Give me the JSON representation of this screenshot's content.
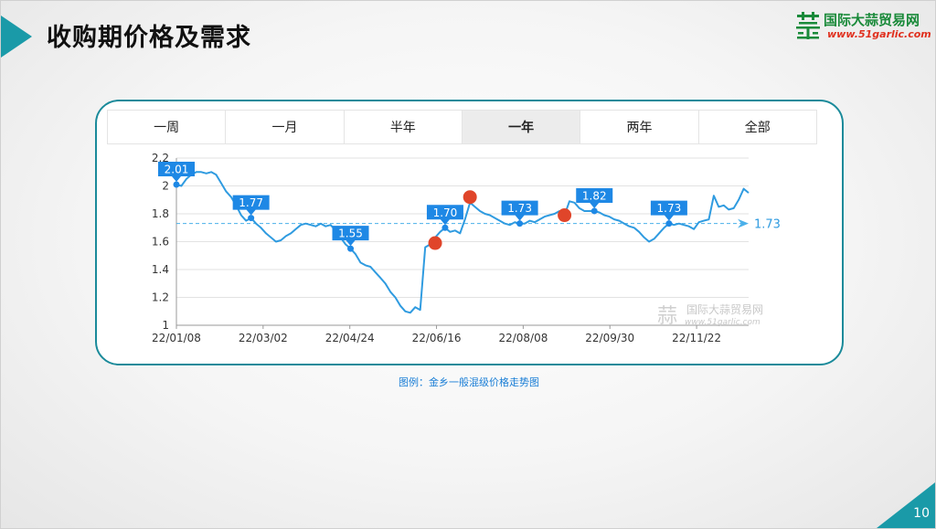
{
  "slide": {
    "title": "收购期价格及需求",
    "page_number": "10",
    "caption": "图例：金乡一般混级价格走势图"
  },
  "logo": {
    "name": "国际大蒜贸易网",
    "url": "www.51garlic.com",
    "icon": "garlic-logo-icon"
  },
  "tabs": [
    {
      "label": "一周",
      "active": false
    },
    {
      "label": "一月",
      "active": false
    },
    {
      "label": "半年",
      "active": false
    },
    {
      "label": "一年",
      "active": true
    },
    {
      "label": "两年",
      "active": false
    },
    {
      "label": "全部",
      "active": false
    }
  ],
  "colors": {
    "accent": "#1a9aa8",
    "line": "#2f9be0",
    "marker": "#e0452a",
    "label_bg": "#1e88e5"
  },
  "chart_data": {
    "type": "line",
    "ylim": [
      1,
      2.2
    ],
    "yticks": [
      1,
      1.2,
      1.4,
      1.6,
      1.8,
      2,
      2.2
    ],
    "xtick_labels": [
      "22/01/08",
      "22/03/02",
      "22/04/24",
      "22/06/16",
      "22/08/08",
      "22/09/30",
      "22/11/22"
    ],
    "grid": true,
    "series": [
      {
        "values": [
          2.01,
          2.0,
          2.05,
          2.08,
          2.1,
          2.1,
          2.09,
          2.1,
          2.08,
          2.02,
          1.96,
          1.92,
          1.86,
          1.79,
          1.75,
          1.77,
          1.73,
          1.7,
          1.66,
          1.63,
          1.6,
          1.61,
          1.64,
          1.66,
          1.69,
          1.72,
          1.73,
          1.72,
          1.71,
          1.73,
          1.71,
          1.72,
          1.68,
          1.63,
          1.58,
          1.55,
          1.51,
          1.45,
          1.43,
          1.42,
          1.38,
          1.34,
          1.3,
          1.24,
          1.2,
          1.14,
          1.1,
          1.09,
          1.13,
          1.11,
          1.56,
          1.58,
          1.63,
          1.67,
          1.7,
          1.67,
          1.68,
          1.66,
          1.76,
          1.88,
          1.85,
          1.82,
          1.8,
          1.79,
          1.77,
          1.75,
          1.73,
          1.72,
          1.74,
          1.73,
          1.73,
          1.75,
          1.74,
          1.76,
          1.78,
          1.79,
          1.8,
          1.82,
          1.79,
          1.89,
          1.88,
          1.84,
          1.82,
          1.82,
          1.82,
          1.81,
          1.79,
          1.78,
          1.76,
          1.75,
          1.73,
          1.71,
          1.7,
          1.67,
          1.63,
          1.6,
          1.62,
          1.66,
          1.7,
          1.73,
          1.72,
          1.73,
          1.72,
          1.71,
          1.69,
          1.74,
          1.75,
          1.76,
          1.93,
          1.85,
          1.86,
          1.83,
          1.84,
          1.9,
          1.98,
          1.95
        ]
      }
    ],
    "reference_line": {
      "value": 1.73,
      "label": "1.73"
    },
    "annotations": [
      {
        "label": "2.01",
        "index": 0,
        "value": 2.01
      },
      {
        "label": "1.77",
        "index": 15,
        "value": 1.77
      },
      {
        "label": "1.55",
        "index": 35,
        "value": 1.55
      },
      {
        "label": "1.70",
        "index": 54,
        "value": 1.7
      },
      {
        "label": "1.73",
        "index": 69,
        "value": 1.73
      },
      {
        "label": "1.82",
        "index": 84,
        "value": 1.82
      },
      {
        "label": "1.73",
        "index": 99,
        "value": 1.73
      }
    ],
    "highlight_points": [
      {
        "index": 52,
        "value": 1.59
      },
      {
        "index": 59,
        "value": 1.92
      },
      {
        "index": 78,
        "value": 1.79
      }
    ],
    "watermark": {
      "name": "国际大蒜贸易网",
      "url": "www.51garlic.com"
    }
  }
}
